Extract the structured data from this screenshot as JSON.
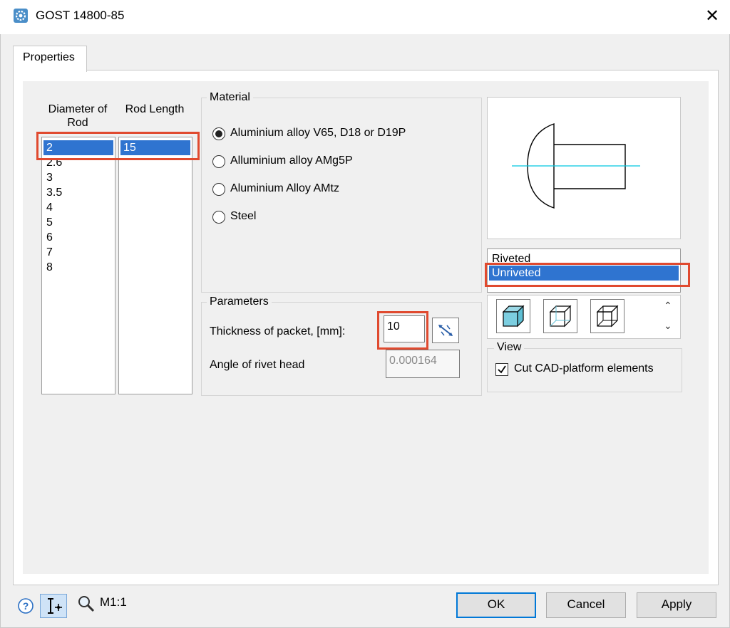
{
  "window": {
    "title": "GOST 14800-85",
    "close_glyph": "✕"
  },
  "tabs": [
    {
      "label": "Properties"
    }
  ],
  "rod_table": {
    "col_diameter": "Diameter of\nRod",
    "col_length": "Rod Length",
    "diameters": [
      "2",
      "2.6",
      "3",
      "3.5",
      "4",
      "5",
      "6",
      "7",
      "8"
    ],
    "selected_diameter": "2",
    "lengths": [
      "15"
    ],
    "selected_length": "15"
  },
  "material": {
    "label": "Material",
    "options": [
      {
        "label": "Aluminium alloy V65, D18 or D19P",
        "checked": true
      },
      {
        "label": "Alluminium alloy AMg5P",
        "checked": false
      },
      {
        "label": "Aluminium Alloy AMtz",
        "checked": false
      },
      {
        "label": "Steel",
        "checked": false
      }
    ]
  },
  "parameters": {
    "label": "Parameters",
    "thickness_label": "Thickness of packet, [mm]:",
    "thickness_value": "10",
    "angle_label": "Angle of rivet head",
    "angle_value": "0.000164"
  },
  "rivet_state": {
    "options": [
      "Riveted",
      "Unriveted"
    ],
    "selected": "Unriveted"
  },
  "view_group": {
    "label": "View",
    "checkbox_label": "Cut CAD-platform elements",
    "checked": true
  },
  "status": {
    "scale": "M1:1"
  },
  "buttons": {
    "ok": "OK",
    "cancel": "Cancel",
    "apply": "Apply"
  },
  "colors": {
    "selection": "#2f74d0",
    "highlight": "#e04a2f",
    "axis": "#00c8e0",
    "default_border": "#0078d7"
  }
}
